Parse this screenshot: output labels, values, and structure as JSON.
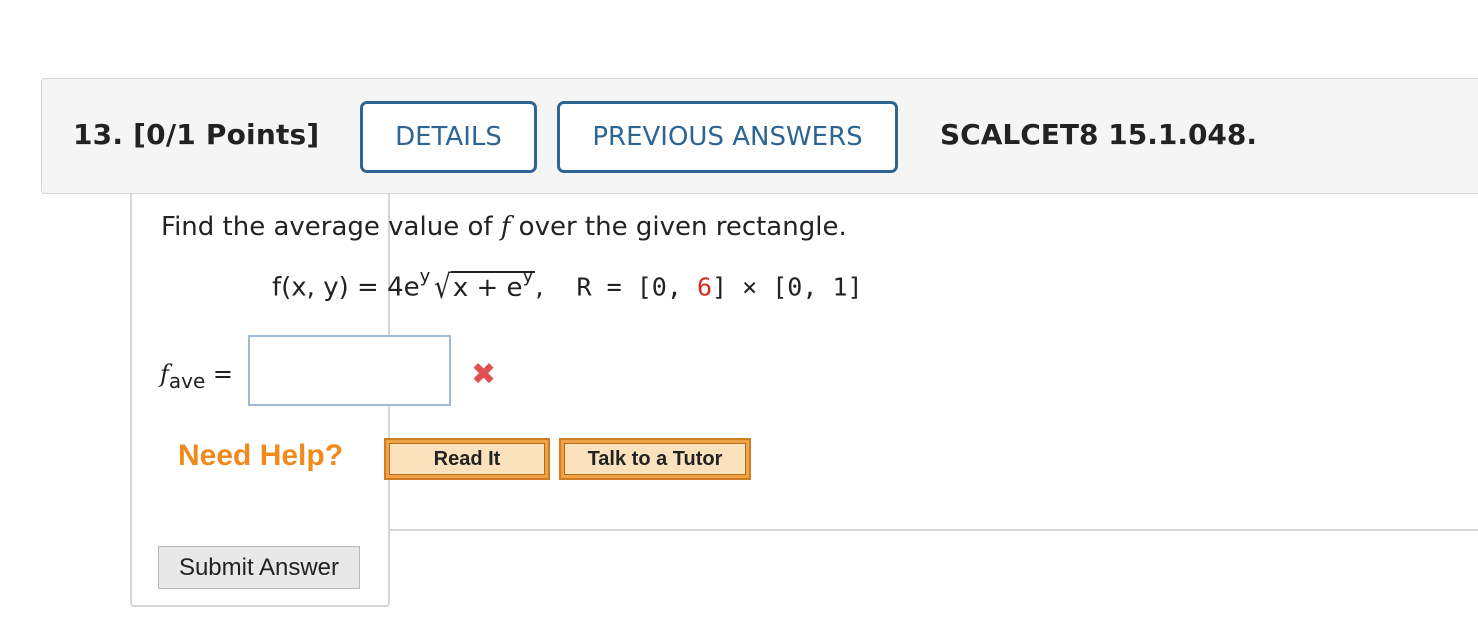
{
  "header": {
    "question_label": "13. [0/1 Points]",
    "details_label": "DETAILS",
    "previous_answers_label": "PREVIOUS ANSWERS",
    "course_code": "SCALCET8 15.1.048."
  },
  "question": {
    "prompt_before": "Find the average value of ",
    "prompt_var": "f",
    "prompt_after": " over the given rectangle.",
    "func_lhs": "f(x, y)",
    "equals": " = ",
    "coef": "4e",
    "exp1": "y",
    "radicand_base": "x + e",
    "exp2": "y",
    "sep": ",",
    "region_start": "R = [0, ",
    "region_highlight": "6",
    "region_end": "] × [0, 1]",
    "answer_label_f": "f",
    "answer_label_sub": "ave",
    "answer_label_eq": " =",
    "answer_value": "",
    "status_icon": "incorrect-x"
  },
  "help": {
    "need_help": "Need Help?",
    "read_it": "Read It",
    "talk_to_tutor": "Talk to a Tutor"
  },
  "actions": {
    "submit": "Submit Answer"
  },
  "colors": {
    "header_accent": "#2f6592",
    "highlight_red": "#d62b1f",
    "help_orange": "#f08a1c"
  }
}
